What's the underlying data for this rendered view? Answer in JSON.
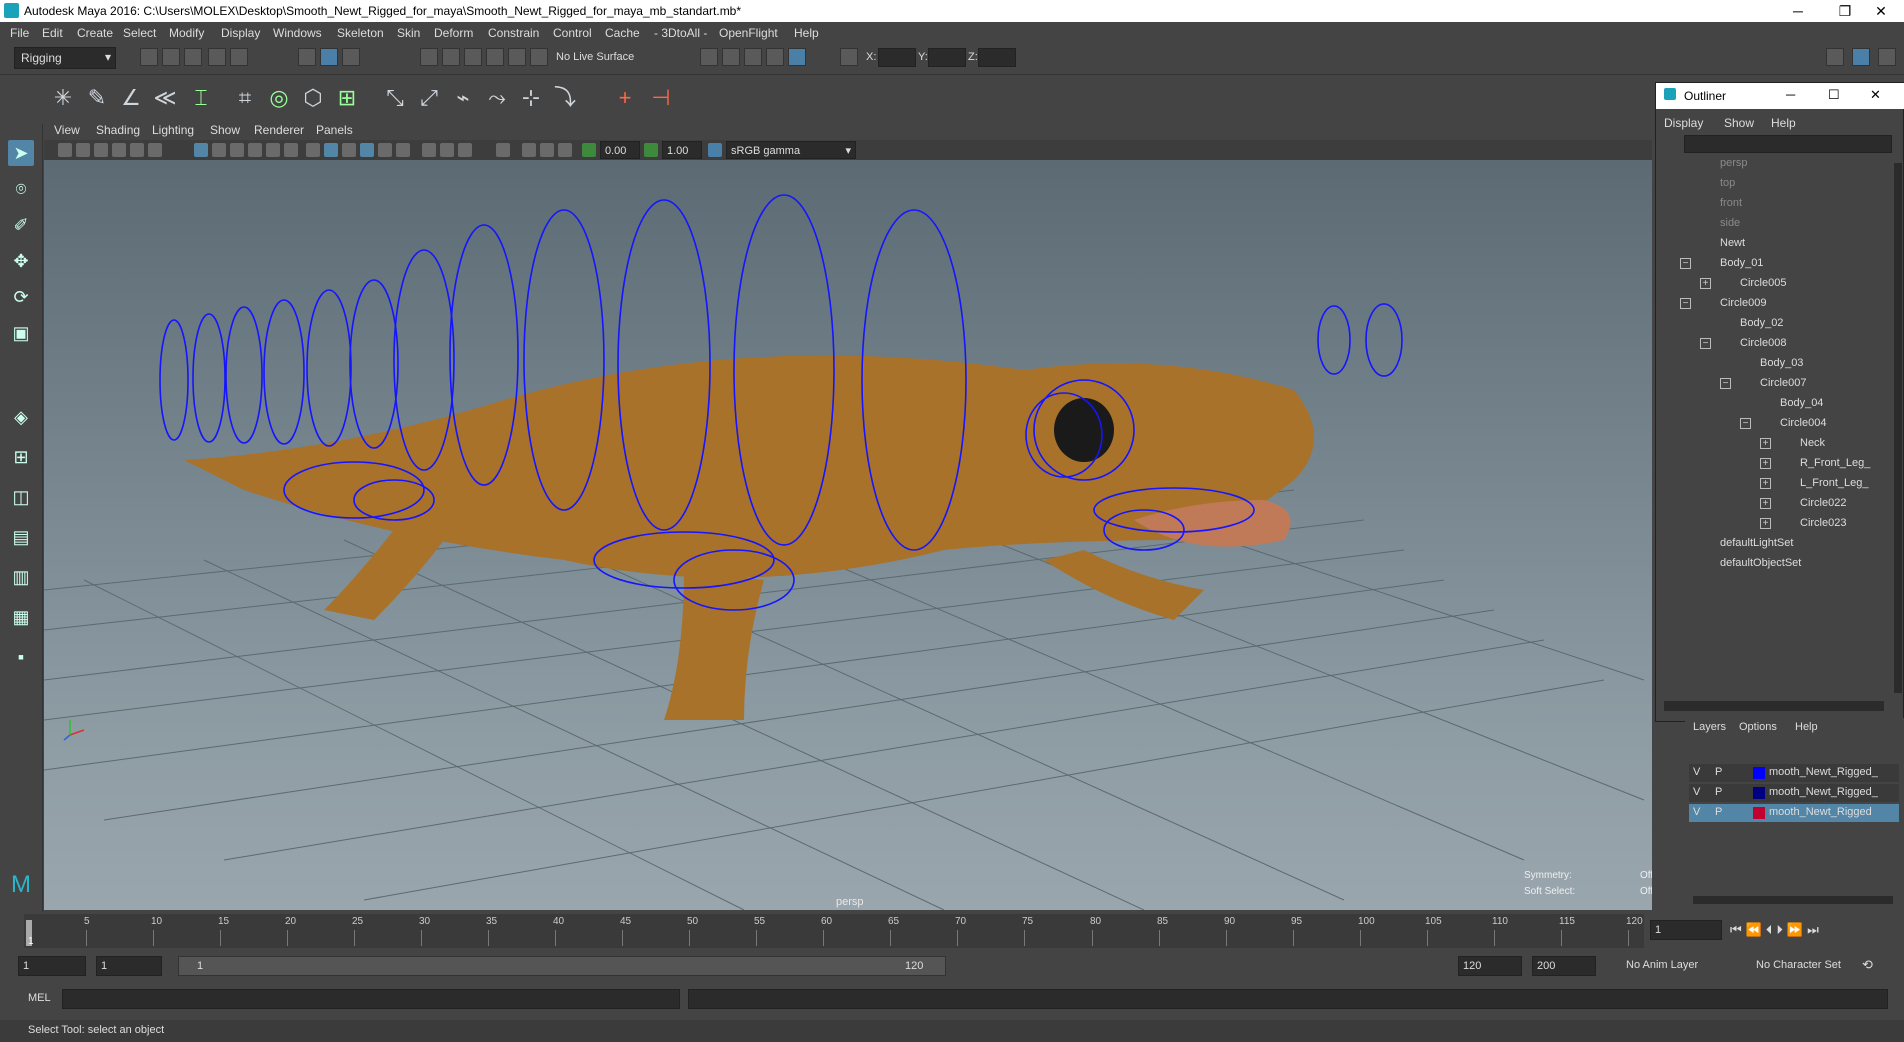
{
  "window": {
    "title": "Autodesk Maya 2016: C:\\Users\\MOLEX\\Desktop\\Smooth_Newt_Rigged_for_maya\\Smooth_Newt_Rigged_for_maya_mb_standart.mb*",
    "minimize": "─",
    "restore": "❐",
    "close": "✕"
  },
  "menu": [
    "File",
    "Edit",
    "Create",
    "Select",
    "Modify",
    "Display",
    "Windows",
    "Skeleton",
    "Skin",
    "Deform",
    "Constrain",
    "Control",
    "Cache",
    "- 3DtoAll -",
    "OpenFlight",
    "Help"
  ],
  "statusline": {
    "menuset": "Rigging",
    "live_surface": "No Live Surface",
    "x_label": "X:",
    "y_label": "Y:",
    "z_label": "Z:"
  },
  "panel": {
    "menus": [
      "View",
      "Shading",
      "Lighting",
      "Show",
      "Renderer",
      "Panels"
    ],
    "exposure": "0.00",
    "gamma": "1.00",
    "color_space": "sRGB gamma",
    "camera_label": "persp",
    "symmetry_label": "Symmetry:",
    "symmetry_value": "Off",
    "soft_select_label": "Soft Select:",
    "soft_select_value": "Off"
  },
  "outliner": {
    "title": "Outliner",
    "menus": [
      "Display",
      "Show",
      "Help"
    ],
    "items": [
      {
        "label": "persp",
        "dim": true
      },
      {
        "label": "top",
        "dim": true
      },
      {
        "label": "front",
        "dim": true
      },
      {
        "label": "side",
        "dim": true
      },
      {
        "label": "Newt",
        "dim": false
      },
      {
        "label": "Body_01",
        "dim": false
      },
      {
        "label": "Circle005",
        "dim": false
      },
      {
        "label": "Circle009",
        "dim": false
      },
      {
        "label": "Body_02",
        "dim": false
      },
      {
        "label": "Circle008",
        "dim": false
      },
      {
        "label": "Body_03",
        "dim": false
      },
      {
        "label": "Circle007",
        "dim": false
      },
      {
        "label": "Body_04",
        "dim": false
      },
      {
        "label": "Circle004",
        "dim": false
      },
      {
        "label": "Neck",
        "dim": false
      },
      {
        "label": "R_Front_Leg_",
        "dim": false
      },
      {
        "label": "L_Front_Leg_",
        "dim": false
      },
      {
        "label": "Circle022",
        "dim": false
      },
      {
        "label": "Circle023",
        "dim": false
      },
      {
        "label": "defaultLightSet",
        "dim": false
      },
      {
        "label": "defaultObjectSet",
        "dim": false
      }
    ]
  },
  "layers": {
    "menus": [
      "Layers",
      "Options",
      "Help"
    ],
    "rows": [
      {
        "v": "V",
        "p": "P",
        "name": "mooth_Newt_Rigged_",
        "color": "#0000ff",
        "selected": false
      },
      {
        "v": "V",
        "p": "P",
        "name": "mooth_Newt_Rigged_",
        "color": "#000080",
        "selected": false
      },
      {
        "v": "V",
        "p": "P",
        "name": "mooth_Newt_Rigged",
        "color": "#c00030",
        "selected": true
      }
    ]
  },
  "timeline": {
    "ticks": [
      "5",
      "10",
      "15",
      "20",
      "25",
      "30",
      "35",
      "40",
      "45",
      "50",
      "55",
      "60",
      "65",
      "70",
      "75",
      "80",
      "85",
      "90",
      "95",
      "100",
      "105",
      "110",
      "115",
      "120"
    ],
    "current_frame": "1",
    "start_marker": "1"
  },
  "range": {
    "start": "1",
    "anim_start": "1",
    "slider_start": "1",
    "slider_end": "120",
    "end": "120",
    "anim_end": "200",
    "anim_layer": "No Anim Layer",
    "character_set": "No Character Set"
  },
  "cmdline": {
    "label": "MEL"
  },
  "helpline": {
    "text": "Select Tool: select an object"
  }
}
